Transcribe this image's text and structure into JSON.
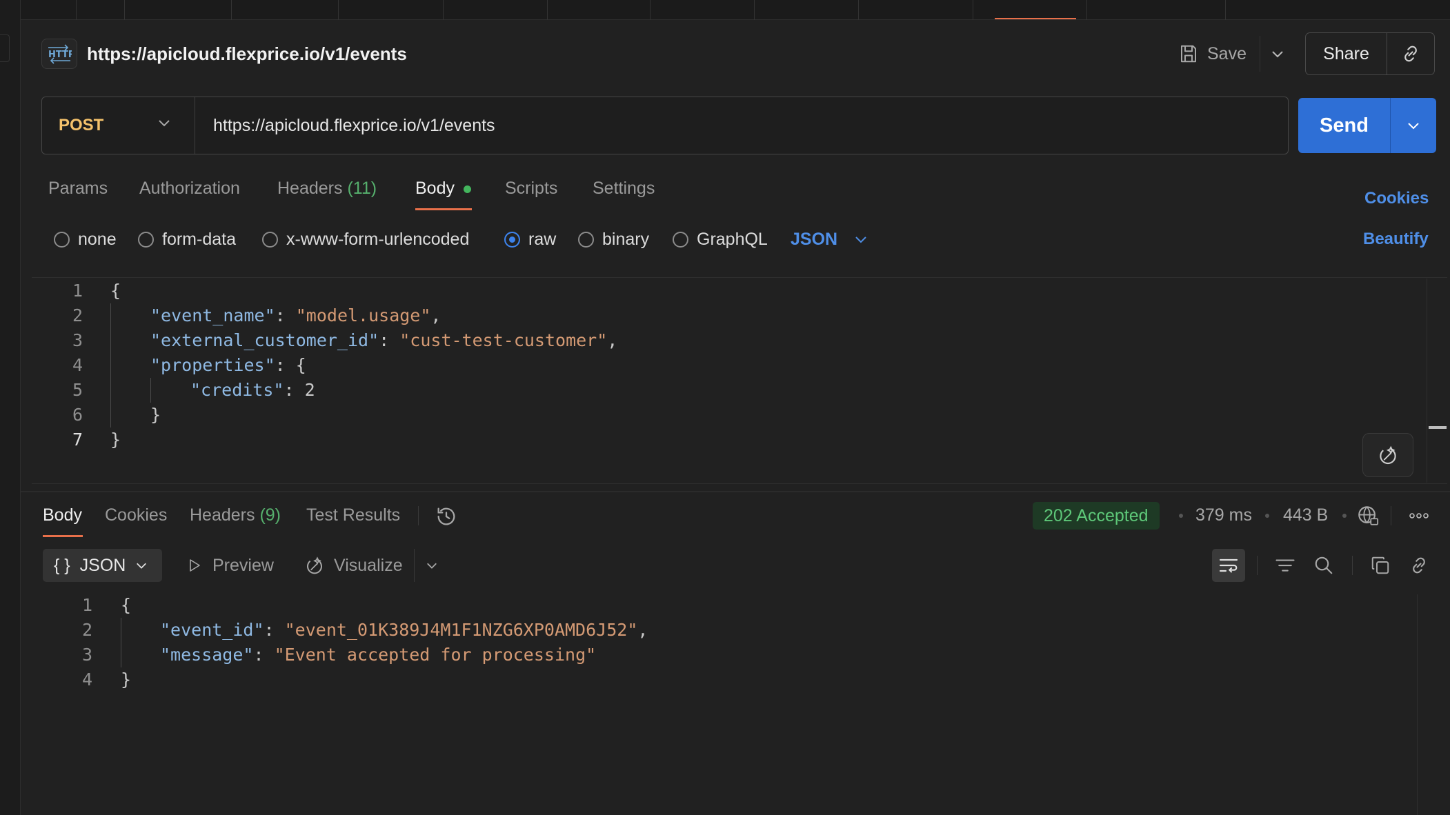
{
  "request": {
    "title": "https://apicloud.flexprice.io/v1/events",
    "save_label": "Save",
    "share_label": "Share",
    "method": "POST",
    "url": "https://apicloud.flexprice.io/v1/events",
    "send_label": "Send"
  },
  "request_tabs": {
    "params": "Params",
    "authorization": "Authorization",
    "headers": "Headers",
    "headers_count": "(11)",
    "body": "Body",
    "scripts": "Scripts",
    "settings": "Settings",
    "cookies": "Cookies"
  },
  "body_types": {
    "none": "none",
    "form_data": "form-data",
    "urlencoded": "x-www-form-urlencoded",
    "raw": "raw",
    "binary": "binary",
    "graphql": "GraphQL",
    "selected": "raw",
    "format": "JSON",
    "beautify": "Beautify"
  },
  "request_body": {
    "line_numbers": [
      "1",
      "2",
      "3",
      "4",
      "5",
      "6",
      "7"
    ],
    "brace_open": "{",
    "brace_close": "}",
    "event_name_key": "\"event_name\"",
    "event_name_value": "\"model.usage\"",
    "external_customer_id_key": "\"external_customer_id\"",
    "external_customer_id_value": "\"cust-test-customer\"",
    "properties_key": "\"properties\"",
    "credits_key": "\"credits\"",
    "credits_value": "2"
  },
  "response_tabs": {
    "body": "Body",
    "cookies": "Cookies",
    "headers": "Headers",
    "headers_count": "(9)",
    "test_results": "Test Results"
  },
  "response_meta": {
    "status": "202 Accepted",
    "time": "379 ms",
    "size": "443 B"
  },
  "response_toolbar": {
    "format": "JSON",
    "format_icon": "{ }",
    "preview": "Preview",
    "visualize": "Visualize"
  },
  "response_body": {
    "line_numbers": [
      "1",
      "2",
      "3",
      "4"
    ],
    "brace_open": "{",
    "brace_close": "}",
    "event_id_key": "\"event_id\"",
    "event_id_value": "\"event_01K389J4M1F1NZG6XP0AMD6J52\"",
    "message_key": "\"message\"",
    "message_value": "\"Event accepted for processing\""
  },
  "colors": {
    "accent_send": "#2e6fd6",
    "tab_underline": "#e8704a",
    "method_post": "#f5c26b",
    "status_ok": "#5ec879",
    "link": "#4f8fe8"
  }
}
